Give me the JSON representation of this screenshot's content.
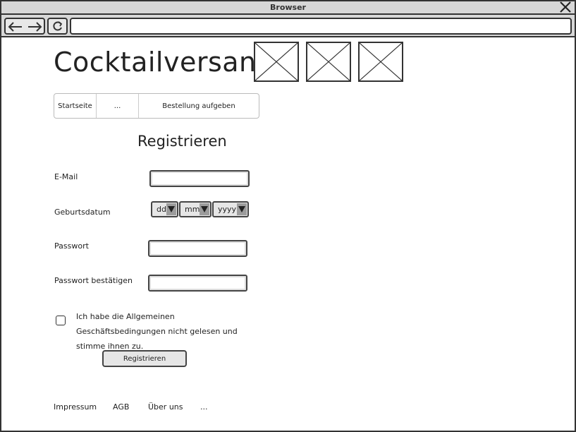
{
  "browser": {
    "title": "Browser"
  },
  "site": {
    "title": "Cocktailversand"
  },
  "nav": {
    "items": [
      {
        "label": "Startseite"
      },
      {
        "label": "..."
      },
      {
        "label": "Bestellung aufgeben"
      }
    ]
  },
  "form": {
    "heading": "Registrieren",
    "email_label": "E-Mail",
    "birthdate_label": "Geburtsdatum",
    "birthdate": {
      "day": "dd",
      "month": "mm",
      "year": "yyyy"
    },
    "password_label": "Passwort",
    "password_confirm_label": "Passwort bestätigen",
    "terms_text": "Ich habe die Allgemeinen Geschäftsbedingungen nicht gelesen und stimme ihnen zu.",
    "terms_checked": false,
    "submit_label": "Registrieren"
  },
  "footer": {
    "links": [
      {
        "label": "Impressum"
      },
      {
        "label": "AGB"
      },
      {
        "label": "Über uns"
      },
      {
        "label": "..."
      }
    ]
  },
  "icons": {
    "close": "close-icon",
    "back": "arrow-left-icon",
    "forward": "arrow-right-icon",
    "reload": "reload-icon",
    "image": "image-placeholder-icon"
  }
}
